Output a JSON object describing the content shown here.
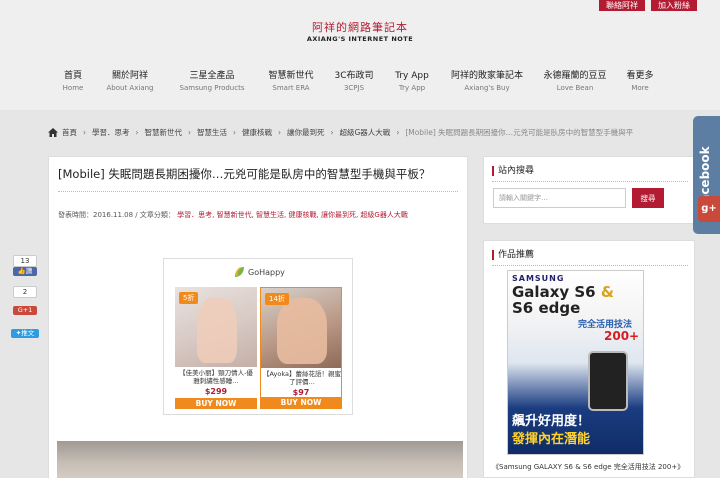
{
  "header": {
    "top_buttons": [
      "聯絡阿祥",
      "加入粉絲"
    ],
    "logo_cn": "阿祥的網路筆記本",
    "logo_en": "AXIANG'S INTERNET NOTE"
  },
  "nav": [
    {
      "main": "首頁",
      "sub": "Home"
    },
    {
      "main": "關於阿祥",
      "sub": "About Axiang"
    },
    {
      "main": "三星全產品",
      "sub": "Samsung Products"
    },
    {
      "main": "智慧新世代",
      "sub": "Smart ERA"
    },
    {
      "main": "3C布政司",
      "sub": "3CPJS"
    },
    {
      "main": "Try App",
      "sub": "Try App"
    },
    {
      "main": "阿祥的敗家筆記本",
      "sub": "Axiang's Buy"
    },
    {
      "main": "永德羅蘭的豆豆",
      "sub": "Love Bean"
    },
    {
      "main": "看更多",
      "sub": "More"
    }
  ],
  "breadcrumb": {
    "items": [
      "首頁",
      "學習．思考",
      "智慧新世代",
      "智慧生活",
      "健康核戰",
      "讓你最到死",
      "超級G器人大戰"
    ],
    "current": "[Mobile] 失眠問題長期困擾你…元兇可能是臥房中的智慧型手機與平"
  },
  "article": {
    "title": "[Mobile] 失眠問題長期困擾你…元兇可能是臥房中的智慧型手機與平板？",
    "meta_date": "發表時間：2016.11.08 /",
    "meta_cat_label": "文章分類：",
    "meta_cats": "學習．思考, 智慧新世代, 智慧生活, 健康核戰, 讓你最到死, 超級G器人大戰"
  },
  "ad": {
    "brand": "GoHappy",
    "cards": [
      {
        "discount": "5折",
        "caption": "【佳美小丽】頸刀情人-優雅刺繡性感睡…",
        "price": "$299",
        "buy": "BUY NOW"
      },
      {
        "discount": "14折",
        "caption": "【Ayoka】蕾絲花語！親蜜了評價…",
        "price": "$97",
        "buy": "BUY NOW"
      }
    ]
  },
  "share": {
    "fb_count": "13",
    "fb_label": "讚",
    "gplus_count": "2",
    "gplus_label": "G+1",
    "tw_label": "推文"
  },
  "float": {
    "facebook": "facebook",
    "gplus": "g+"
  },
  "sidebar": {
    "search_title": "站內搜尋",
    "search_placeholder": "請輸入關鍵字…",
    "search_button": "搜尋",
    "book_title": "作品推薦",
    "book": {
      "brand": "SAMSUNG",
      "title1": "Galaxy S6",
      "amp": "&",
      "title2": "S6 edge",
      "sub": "完全活用技法",
      "num": "200+",
      "slogan1": "飆升好用度！",
      "slogan2": "發揮內在潛能"
    },
    "book_caption": "《Samsung GALAXY S6 & S6 edge 完全活用技法 200+》"
  },
  "colors": {
    "accent": "#b31b32",
    "facebook": "#5d7ea3",
    "ad_orange": "#f08a1c"
  }
}
